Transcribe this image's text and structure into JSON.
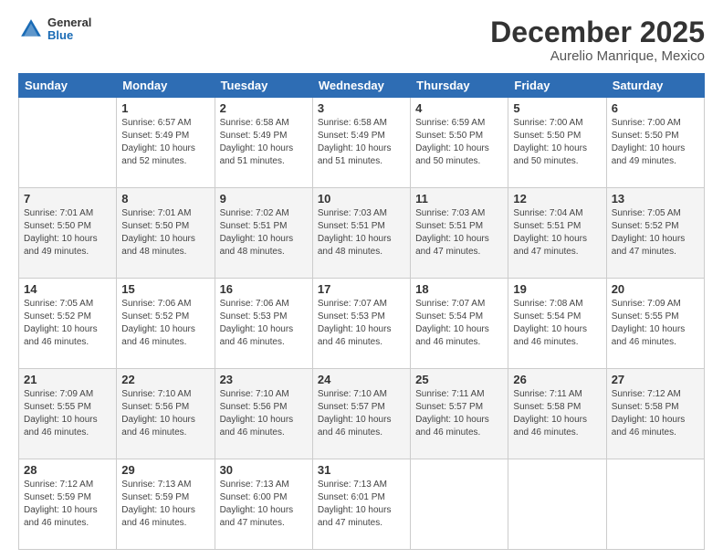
{
  "logo": {
    "line1": "General",
    "line2": "Blue"
  },
  "title": "December 2025",
  "subtitle": "Aurelio Manrique, Mexico",
  "weekdays": [
    "Sunday",
    "Monday",
    "Tuesday",
    "Wednesday",
    "Thursday",
    "Friday",
    "Saturday"
  ],
  "weeks": [
    [
      {
        "day": "",
        "info": ""
      },
      {
        "day": "1",
        "info": "Sunrise: 6:57 AM\nSunset: 5:49 PM\nDaylight: 10 hours\nand 52 minutes."
      },
      {
        "day": "2",
        "info": "Sunrise: 6:58 AM\nSunset: 5:49 PM\nDaylight: 10 hours\nand 51 minutes."
      },
      {
        "day": "3",
        "info": "Sunrise: 6:58 AM\nSunset: 5:49 PM\nDaylight: 10 hours\nand 51 minutes."
      },
      {
        "day": "4",
        "info": "Sunrise: 6:59 AM\nSunset: 5:50 PM\nDaylight: 10 hours\nand 50 minutes."
      },
      {
        "day": "5",
        "info": "Sunrise: 7:00 AM\nSunset: 5:50 PM\nDaylight: 10 hours\nand 50 minutes."
      },
      {
        "day": "6",
        "info": "Sunrise: 7:00 AM\nSunset: 5:50 PM\nDaylight: 10 hours\nand 49 minutes."
      }
    ],
    [
      {
        "day": "7",
        "info": "Sunrise: 7:01 AM\nSunset: 5:50 PM\nDaylight: 10 hours\nand 49 minutes."
      },
      {
        "day": "8",
        "info": "Sunrise: 7:01 AM\nSunset: 5:50 PM\nDaylight: 10 hours\nand 48 minutes."
      },
      {
        "day": "9",
        "info": "Sunrise: 7:02 AM\nSunset: 5:51 PM\nDaylight: 10 hours\nand 48 minutes."
      },
      {
        "day": "10",
        "info": "Sunrise: 7:03 AM\nSunset: 5:51 PM\nDaylight: 10 hours\nand 48 minutes."
      },
      {
        "day": "11",
        "info": "Sunrise: 7:03 AM\nSunset: 5:51 PM\nDaylight: 10 hours\nand 47 minutes."
      },
      {
        "day": "12",
        "info": "Sunrise: 7:04 AM\nSunset: 5:51 PM\nDaylight: 10 hours\nand 47 minutes."
      },
      {
        "day": "13",
        "info": "Sunrise: 7:05 AM\nSunset: 5:52 PM\nDaylight: 10 hours\nand 47 minutes."
      }
    ],
    [
      {
        "day": "14",
        "info": "Sunrise: 7:05 AM\nSunset: 5:52 PM\nDaylight: 10 hours\nand 46 minutes."
      },
      {
        "day": "15",
        "info": "Sunrise: 7:06 AM\nSunset: 5:52 PM\nDaylight: 10 hours\nand 46 minutes."
      },
      {
        "day": "16",
        "info": "Sunrise: 7:06 AM\nSunset: 5:53 PM\nDaylight: 10 hours\nand 46 minutes."
      },
      {
        "day": "17",
        "info": "Sunrise: 7:07 AM\nSunset: 5:53 PM\nDaylight: 10 hours\nand 46 minutes."
      },
      {
        "day": "18",
        "info": "Sunrise: 7:07 AM\nSunset: 5:54 PM\nDaylight: 10 hours\nand 46 minutes."
      },
      {
        "day": "19",
        "info": "Sunrise: 7:08 AM\nSunset: 5:54 PM\nDaylight: 10 hours\nand 46 minutes."
      },
      {
        "day": "20",
        "info": "Sunrise: 7:09 AM\nSunset: 5:55 PM\nDaylight: 10 hours\nand 46 minutes."
      }
    ],
    [
      {
        "day": "21",
        "info": "Sunrise: 7:09 AM\nSunset: 5:55 PM\nDaylight: 10 hours\nand 46 minutes."
      },
      {
        "day": "22",
        "info": "Sunrise: 7:10 AM\nSunset: 5:56 PM\nDaylight: 10 hours\nand 46 minutes."
      },
      {
        "day": "23",
        "info": "Sunrise: 7:10 AM\nSunset: 5:56 PM\nDaylight: 10 hours\nand 46 minutes."
      },
      {
        "day": "24",
        "info": "Sunrise: 7:10 AM\nSunset: 5:57 PM\nDaylight: 10 hours\nand 46 minutes."
      },
      {
        "day": "25",
        "info": "Sunrise: 7:11 AM\nSunset: 5:57 PM\nDaylight: 10 hours\nand 46 minutes."
      },
      {
        "day": "26",
        "info": "Sunrise: 7:11 AM\nSunset: 5:58 PM\nDaylight: 10 hours\nand 46 minutes."
      },
      {
        "day": "27",
        "info": "Sunrise: 7:12 AM\nSunset: 5:58 PM\nDaylight: 10 hours\nand 46 minutes."
      }
    ],
    [
      {
        "day": "28",
        "info": "Sunrise: 7:12 AM\nSunset: 5:59 PM\nDaylight: 10 hours\nand 46 minutes."
      },
      {
        "day": "29",
        "info": "Sunrise: 7:13 AM\nSunset: 5:59 PM\nDaylight: 10 hours\nand 46 minutes."
      },
      {
        "day": "30",
        "info": "Sunrise: 7:13 AM\nSunset: 6:00 PM\nDaylight: 10 hours\nand 47 minutes."
      },
      {
        "day": "31",
        "info": "Sunrise: 7:13 AM\nSunset: 6:01 PM\nDaylight: 10 hours\nand 47 minutes."
      },
      {
        "day": "",
        "info": ""
      },
      {
        "day": "",
        "info": ""
      },
      {
        "day": "",
        "info": ""
      }
    ]
  ]
}
